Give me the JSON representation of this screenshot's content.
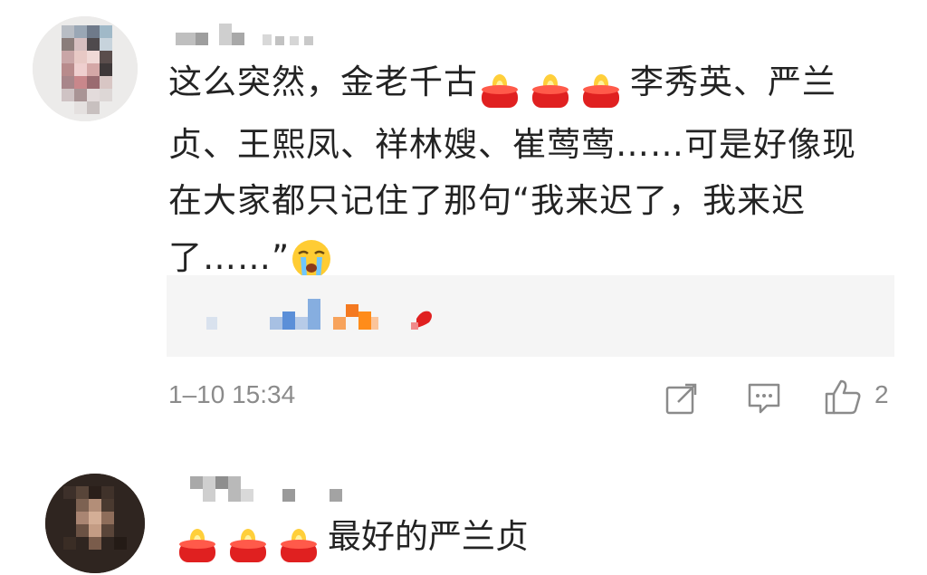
{
  "comments": [
    {
      "avatar_icon": "pixelated-avatar",
      "username_icon": "pixelated-username",
      "text_parts": {
        "before_candles": "这么突然，金老千古",
        "after_candles": "李秀英、严兰贞、王熙凤、祥林嫂、崔莺莺……可是好像现在大家都只记住了那句“我来迟了，我来迟了……”"
      },
      "candle_count": 3,
      "candle_icon": "candle-emoji",
      "end_icon": "crying-face-emoji",
      "reply_preview_icon": "pixelated-reply",
      "timestamp": "1–10 15:34",
      "actions": {
        "share_icon": "share-icon",
        "comment_icon": "comment-icon",
        "like_icon": "thumbs-up-icon",
        "like_count": "2"
      }
    },
    {
      "avatar_icon": "pixelated-avatar",
      "username_icon": "pixelated-username",
      "candle_count": 3,
      "candle_icon": "candle-emoji",
      "text": "最好的严兰贞"
    }
  ],
  "colors": {
    "text": "#232323",
    "meta": "#8b8b8b",
    "reply_bg": "#f5f5f5",
    "candle_red": "#e02020",
    "flame_yellow": "#ffb300"
  }
}
